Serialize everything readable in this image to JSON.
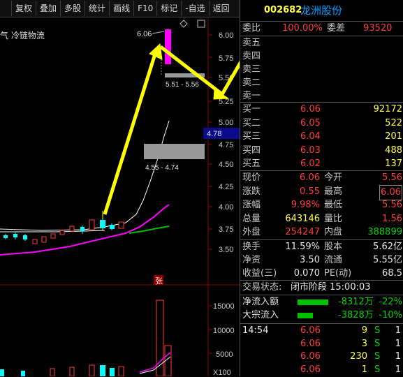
{
  "toolbar": {
    "items": [
      "复权",
      "叠加",
      "多股",
      "统计",
      "画线",
      "F10",
      "标记",
      "-自选",
      "返回"
    ]
  },
  "chart": {
    "title": "气 冷链物流",
    "price_axis": [
      "6.00",
      "5.75",
      "5.50",
      "5.25",
      "5.00",
      "4.75",
      "4.50",
      "4.25",
      "4.00",
      "3.75",
      "3.50"
    ],
    "volume_axis": [
      "15000",
      "10000",
      "5000",
      "X100"
    ],
    "current_price_tag": "4.78",
    "high_label": "6.06",
    "box_upper_label": "5.51 - 5.56",
    "box_lower_label": "4.55 - 4.74",
    "limit_up_tag": "张",
    "colors": {
      "up": "#ff3c3c",
      "down": "#00ffff",
      "ma1": "#ffffff",
      "ma2": "#ff00ff",
      "ma3": "#00c000",
      "arrow": "#ffff00"
    }
  },
  "quote": {
    "code": "002682",
    "name": "龙洲股份",
    "weibi_label": "委比",
    "weibi_value": "100.00%",
    "weicha_label": "委差",
    "weicha_value": "93520",
    "asks": [
      {
        "label": "卖五",
        "price": "",
        "vol": ""
      },
      {
        "label": "卖四",
        "price": "",
        "vol": ""
      },
      {
        "label": "卖三",
        "price": "",
        "vol": ""
      },
      {
        "label": "卖二",
        "price": "",
        "vol": ""
      },
      {
        "label": "卖一",
        "price": "",
        "vol": ""
      }
    ],
    "bids": [
      {
        "label": "买一",
        "price": "6.06",
        "vol": "92172"
      },
      {
        "label": "买二",
        "price": "6.05",
        "vol": "522"
      },
      {
        "label": "买三",
        "price": "6.04",
        "vol": "201"
      },
      {
        "label": "买四",
        "price": "6.03",
        "vol": "488"
      },
      {
        "label": "买五",
        "price": "6.02",
        "vol": "137"
      }
    ],
    "stats": [
      {
        "l1": "现价",
        "v1": "6.06",
        "c1": "red",
        "l2": "今开",
        "v2": "5.56",
        "c2": "red"
      },
      {
        "l1": "涨跌",
        "v1": "0.55",
        "c1": "red",
        "l2": "最高",
        "v2": "6.06",
        "c2": "red"
      },
      {
        "l1": "涨幅",
        "v1": "9.98%",
        "c1": "red",
        "l2": "最低",
        "v2": "5.56",
        "c2": "red"
      },
      {
        "l1": "总量",
        "v1": "643146",
        "c1": "yellow",
        "l2": "量比",
        "v2": "1.56",
        "c2": "red"
      },
      {
        "l1": "外盘",
        "v1": "254247",
        "c1": "red",
        "l2": "内盘",
        "v2": "388899",
        "c2": "green"
      }
    ],
    "fundamentals": [
      {
        "l1": "换手",
        "v1": "11.59%",
        "l2": "股本",
        "v2": "5.62亿"
      },
      {
        "l1": "净资",
        "v1": "3.50",
        "l2": "流通",
        "v2": "5.55亿"
      },
      {
        "l1": "收益(三)",
        "v1": "0.070",
        "l2": "PE(动)",
        "v2": "68.5"
      }
    ],
    "trade_status_label": "交易状态:",
    "trade_status_value": "闭市阶段 15:00:03",
    "flows": [
      {
        "label": "净流入额",
        "amount": "-8312万",
        "pct": "-22%"
      },
      {
        "label": "大宗流入",
        "amount": "-3828万",
        "pct": "-10%"
      }
    ],
    "ticks": [
      {
        "time": "14:54",
        "price": "6.06",
        "vol": "9",
        "side": "S",
        "num": "1"
      },
      {
        "time": "",
        "price": "6.06",
        "vol": "3",
        "side": "S",
        "num": "1"
      },
      {
        "time": "",
        "price": "6.06",
        "vol": "230",
        "side": "S",
        "num": "1"
      },
      {
        "time": "",
        "price": "6.06",
        "vol": "1",
        "side": "S",
        "num": "1"
      }
    ]
  }
}
